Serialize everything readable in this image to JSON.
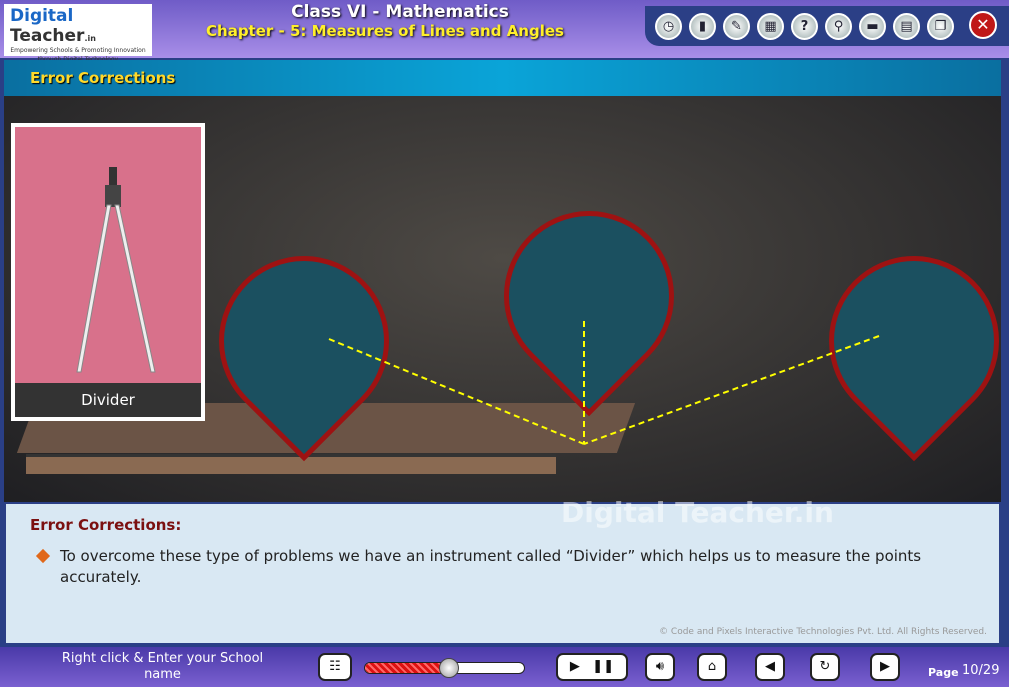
{
  "header": {
    "logo_brand_1": "Digital",
    "logo_brand_2": "Teacher",
    "logo_suffix": ".in",
    "logo_tagline": "Empowering Schools & Promoting Innovation through Digital Technology",
    "title": "Class VI - Mathematics",
    "chapter": "Chapter - 5: Measures of Lines and Angles"
  },
  "toolbar": [
    {
      "icon": "clock-icon",
      "glyph": "◷"
    },
    {
      "icon": "book-icon",
      "glyph": "▮"
    },
    {
      "icon": "pencil-icon",
      "glyph": "✎"
    },
    {
      "icon": "calendar-icon",
      "glyph": "▦"
    },
    {
      "icon": "help-icon",
      "glyph": "?"
    },
    {
      "icon": "search-icon",
      "glyph": "⚲"
    },
    {
      "icon": "dictionary-icon",
      "glyph": "▬"
    },
    {
      "icon": "notes-icon",
      "glyph": "▤"
    },
    {
      "icon": "window-icon",
      "glyph": "❐"
    }
  ],
  "close_glyph": "✕",
  "section": {
    "title": "Error Corrections"
  },
  "card": {
    "label": "Divider"
  },
  "watermark": "Digital Teacher.in",
  "content": {
    "heading": "Error Corrections:",
    "bullet": "To overcome these type of problems we have an instrument called “Divider” which helps us to measure the points accurately.",
    "copyright": "© Code and Pixels Interactive Technologies  Pvt. Ltd. All Rights Reserved."
  },
  "footer": {
    "school": "Right click & Enter your School name",
    "progress_percent": 53,
    "page_label": "Page",
    "page": "10/29"
  }
}
